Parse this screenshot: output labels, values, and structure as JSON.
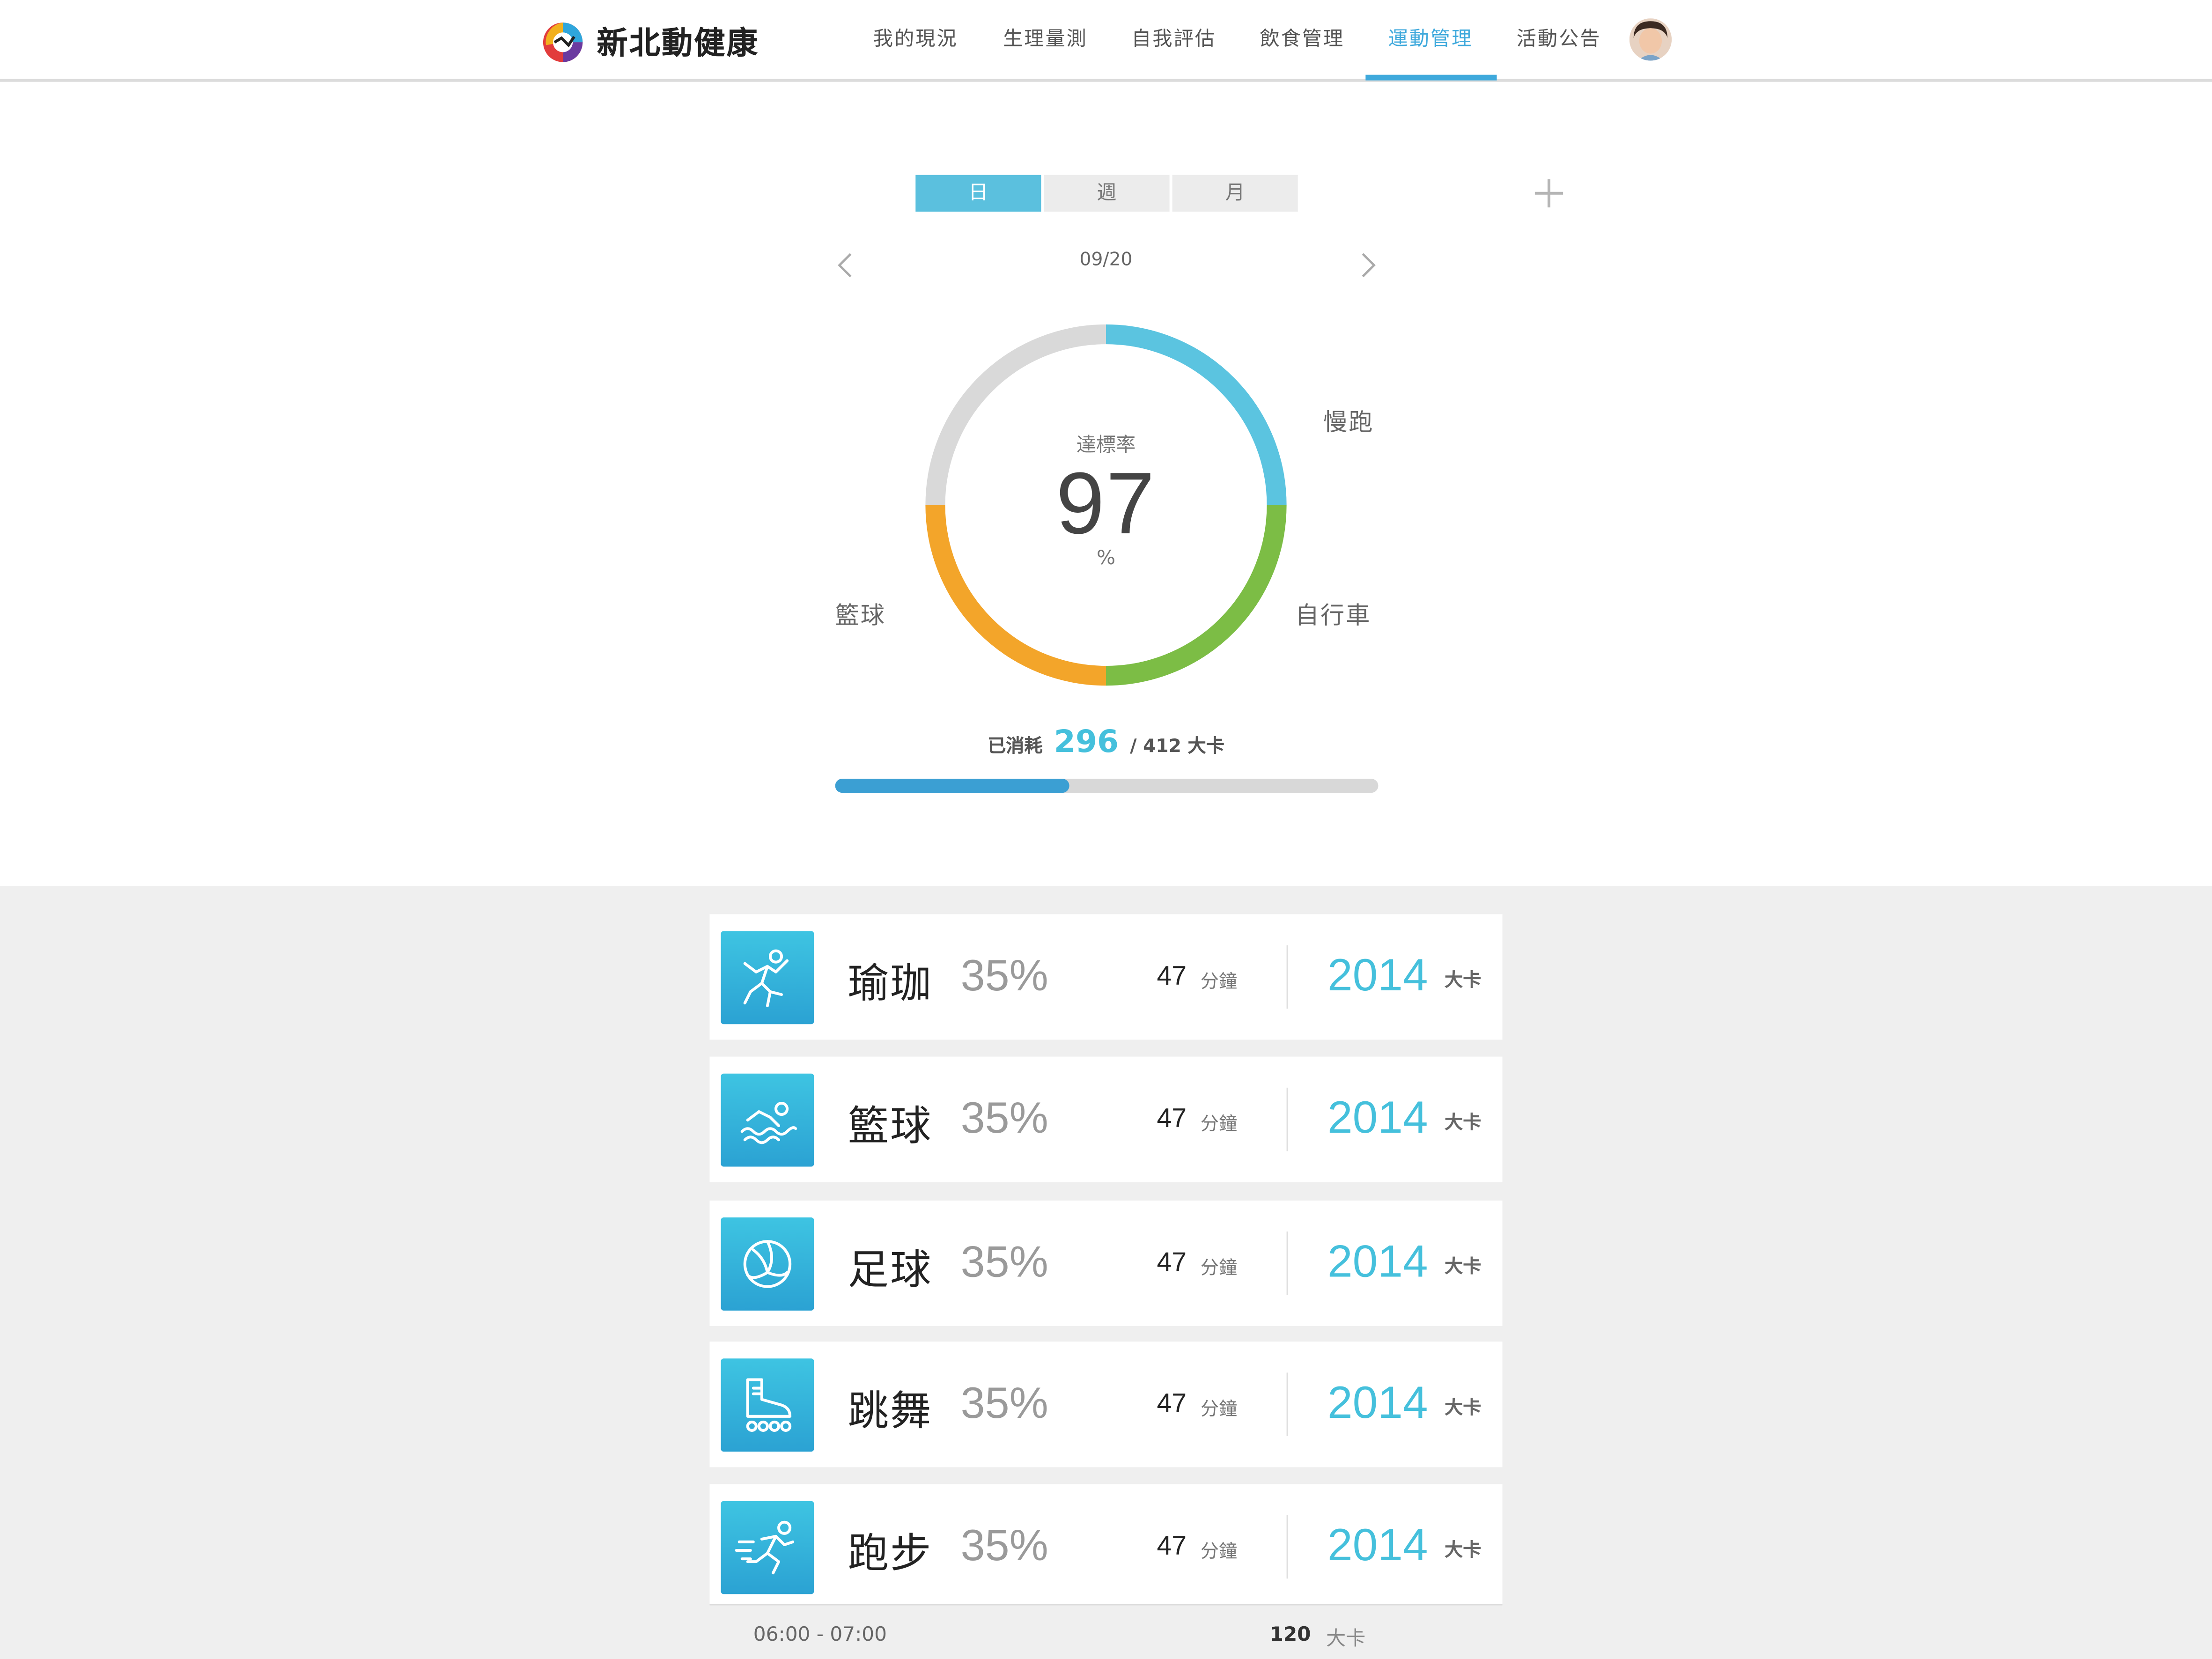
{
  "brand": {
    "name": "新北動健康"
  },
  "nav": {
    "items": [
      {
        "label": "我的現況",
        "active": false
      },
      {
        "label": "生理量測",
        "active": false
      },
      {
        "label": "自我評估",
        "active": false
      },
      {
        "label": "飲食管理",
        "active": false
      },
      {
        "label": "運動管理",
        "active": true
      },
      {
        "label": "活動公告",
        "active": false
      }
    ],
    "accent_color": "#3fa9dc"
  },
  "period_tabs": [
    {
      "label": "日",
      "active": true
    },
    {
      "label": "週",
      "active": false
    },
    {
      "label": "月",
      "active": false
    }
  ],
  "date": "09/20",
  "ring": {
    "caption": "達標率",
    "value": "97",
    "unit": "%",
    "segments": [
      {
        "label": "慢跑",
        "fraction": 0.25,
        "color": "#5bc4e0"
      },
      {
        "label": "自行車",
        "fraction": 0.25,
        "color": "#7cbd45"
      },
      {
        "label": "籃球",
        "fraction": 0.25,
        "color": "#f3a52a"
      },
      {
        "label": "",
        "fraction": 0.25,
        "color": "#d9d9d9"
      }
    ]
  },
  "calories": {
    "consumed_label": "已消耗",
    "consumed": "296",
    "total_text": "/ 412 大卡",
    "progress_fraction": 0.43
  },
  "activities": [
    {
      "name": "瑜珈",
      "percent": "35%",
      "minutes": "47",
      "minutes_unit": "分鐘",
      "kcal": "2014",
      "kcal_unit": "大卡",
      "icon": "yoga-person-icon"
    },
    {
      "name": "籃球",
      "percent": "35%",
      "minutes": "47",
      "minutes_unit": "分鐘",
      "kcal": "2014",
      "kcal_unit": "大卡",
      "icon": "swimmer-icon"
    },
    {
      "name": "足球",
      "percent": "35%",
      "minutes": "47",
      "minutes_unit": "分鐘",
      "kcal": "2014",
      "kcal_unit": "大卡",
      "icon": "volleyball-icon"
    },
    {
      "name": "跳舞",
      "percent": "35%",
      "minutes": "47",
      "minutes_unit": "分鐘",
      "kcal": "2014",
      "kcal_unit": "大卡",
      "icon": "roller-skate-icon"
    },
    {
      "name": "跑步",
      "percent": "35%",
      "minutes": "47",
      "minutes_unit": "分鐘",
      "kcal": "2014",
      "kcal_unit": "大卡",
      "icon": "running-person-icon"
    }
  ],
  "detail": {
    "time": "06:00 - 07:00",
    "kcal": "120",
    "kcal_unit": "大卡"
  }
}
